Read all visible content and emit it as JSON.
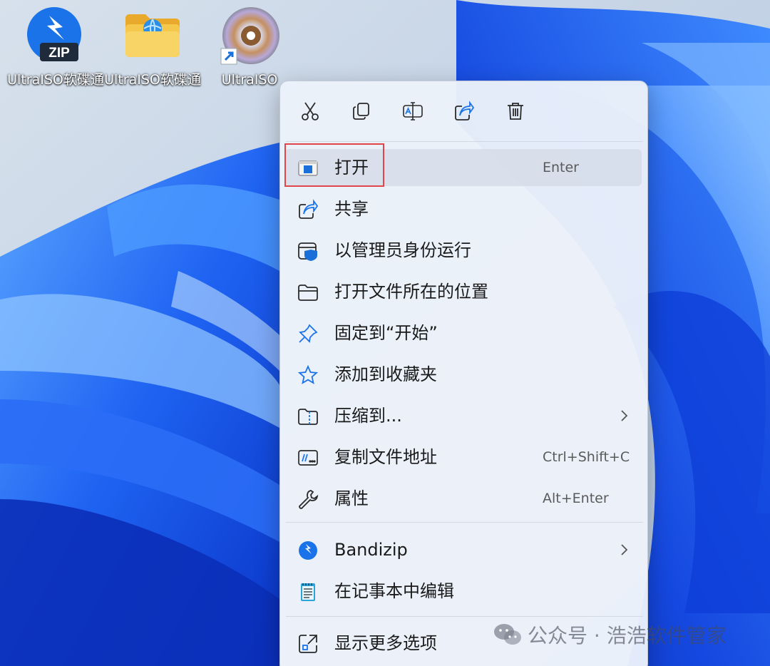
{
  "desktop": {
    "icons": [
      {
        "label": "UltraISO软碟通",
        "icon": "bandizip-zip-icon"
      },
      {
        "label": "UltraISO软碟通",
        "icon": "folder-globe-icon"
      },
      {
        "label": "UltraISO",
        "icon": "ultraiso-disc-shortcut-icon"
      }
    ]
  },
  "context_menu": {
    "toolbar": [
      {
        "name": "cut",
        "icon": "scissors-icon"
      },
      {
        "name": "copy",
        "icon": "copy-icon"
      },
      {
        "name": "rename",
        "icon": "rename-icon"
      },
      {
        "name": "share",
        "icon": "share-icon"
      },
      {
        "name": "delete",
        "icon": "trash-icon"
      }
    ],
    "items": [
      {
        "label": "打开",
        "shortcut": "Enter",
        "icon": "app-window-icon",
        "selected": true
      },
      {
        "label": "共享",
        "shortcut": "",
        "icon": "share-icon"
      },
      {
        "label": "以管理员身份运行",
        "shortcut": "",
        "icon": "admin-shield-icon"
      },
      {
        "label": "打开文件所在的位置",
        "shortcut": "",
        "icon": "folder-icon"
      },
      {
        "label": "固定到“开始”",
        "shortcut": "",
        "icon": "pin-icon"
      },
      {
        "label": "添加到收藏夹",
        "shortcut": "",
        "icon": "star-icon"
      },
      {
        "label": "压缩到...",
        "shortcut": "",
        "icon": "zip-folder-icon",
        "submenu": true
      },
      {
        "label": "复制文件地址",
        "shortcut": "Ctrl+Shift+C",
        "icon": "copy-path-icon"
      },
      {
        "label": "属性",
        "shortcut": "Alt+Enter",
        "icon": "wrench-icon"
      },
      {
        "label": "Bandizip",
        "shortcut": "",
        "icon": "bandizip-icon",
        "submenu": true
      },
      {
        "label": "在记事本中编辑",
        "shortcut": "",
        "icon": "notepad-icon"
      },
      {
        "label": "显示更多选项",
        "shortcut": "",
        "icon": "more-options-icon"
      }
    ]
  },
  "watermark": {
    "text": "公众号 · 浩浩软件管家",
    "icon": "wechat-icon"
  },
  "colors": {
    "accent": "#1a73e8",
    "highlight_box": "#e0454a",
    "wallpaper_blue": "#1d5bf0"
  }
}
